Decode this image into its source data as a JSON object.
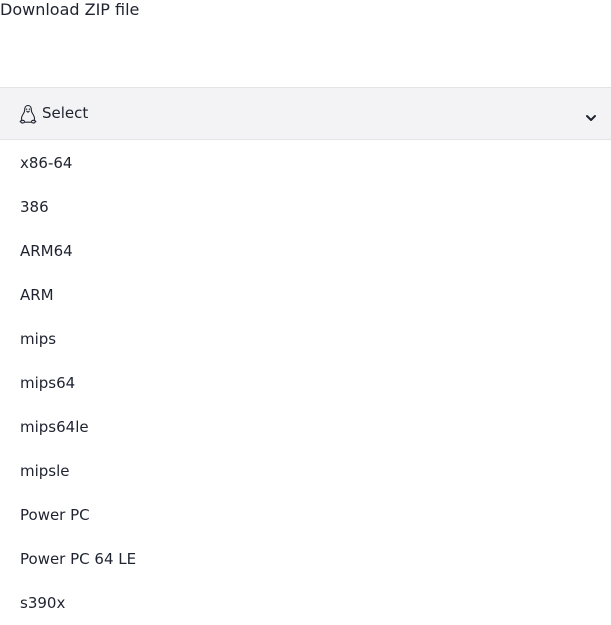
{
  "download": {
    "label": "Download ZIP file"
  },
  "select": {
    "icon": "linux-tux-icon",
    "label": "Select",
    "chevron_icon": "chevron-down-icon"
  },
  "options": [
    {
      "label": "x86-64"
    },
    {
      "label": "386"
    },
    {
      "label": "ARM64"
    },
    {
      "label": "ARM"
    },
    {
      "label": "mips"
    },
    {
      "label": "mips64"
    },
    {
      "label": "mips64le"
    },
    {
      "label": "mipsle"
    },
    {
      "label": "Power PC"
    },
    {
      "label": "Power PC 64 LE"
    },
    {
      "label": "s390x"
    }
  ]
}
